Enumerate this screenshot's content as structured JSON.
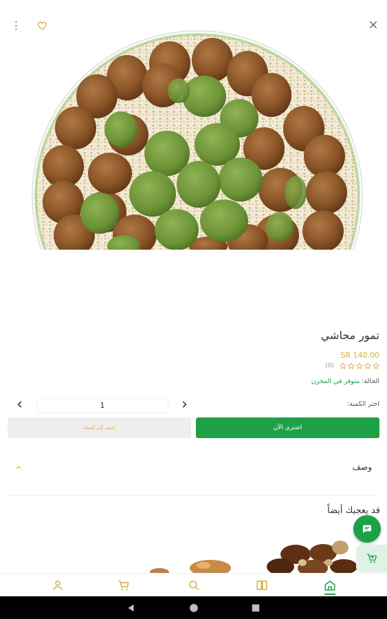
{
  "header": {
    "menu_icon": "kebab-icon",
    "favorite_icon": "heart-icon",
    "close_icon": "close-icon"
  },
  "product": {
    "name": "تمور محاشي",
    "price": "SR 140.00",
    "rating": {
      "stars": 0,
      "max": 5,
      "count": "(0)"
    },
    "stock_label": "الحالة:",
    "stock_value": "متوفر في المخزن",
    "quantity_label": "اختر الكمية:",
    "quantity": "1"
  },
  "actions": {
    "buy_now": "اشتري الآن",
    "add_to_cart": "اضف إلى السلة"
  },
  "description": {
    "title": "وصف"
  },
  "recommendations": {
    "title": "قد يعجبك أيضاً"
  },
  "colors": {
    "primary": "#1ea047",
    "accent": "#d8ae3c"
  },
  "bottom_nav": {
    "items": [
      "account-icon",
      "cart-icon",
      "search-icon",
      "catalog-icon",
      "home-icon"
    ],
    "active": "home-icon"
  },
  "system_nav": [
    "back-icon",
    "home-circle-icon",
    "recents-icon"
  ]
}
